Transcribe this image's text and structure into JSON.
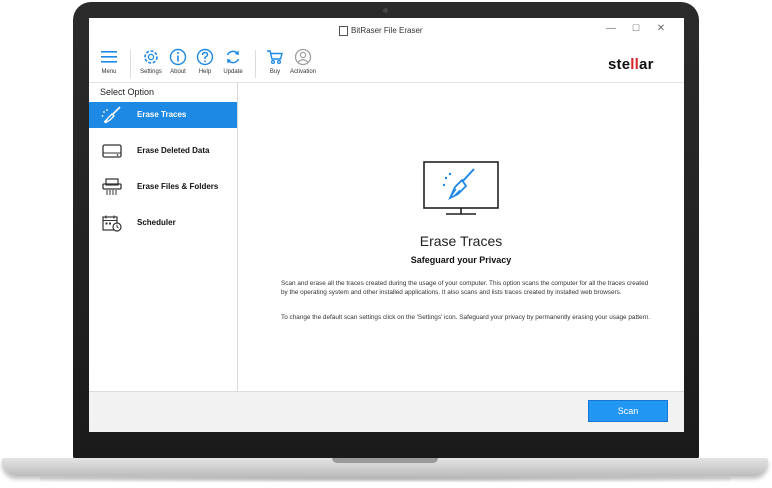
{
  "window": {
    "title": "BitRaser File Eraser",
    "controls": {
      "minimize": "—",
      "maximize": "☐",
      "close": "✕"
    }
  },
  "toolbar": {
    "items": [
      {
        "label": "Menu",
        "icon": "hamburger-icon"
      },
      {
        "label": "Settings",
        "icon": "gear-icon"
      },
      {
        "label": "About",
        "icon": "info-icon"
      },
      {
        "label": "Help",
        "icon": "help-icon"
      },
      {
        "label": "Update",
        "icon": "refresh-icon"
      },
      {
        "label": "Buy",
        "icon": "cart-icon"
      },
      {
        "label": "Activation",
        "icon": "user-icon"
      }
    ],
    "logo": {
      "pre": "ste",
      "mid": "ll",
      "post": "ar"
    }
  },
  "sidebar": {
    "title": "Select Option",
    "items": [
      {
        "label": "Erase Traces",
        "icon": "broom-icon",
        "active": true
      },
      {
        "label": "Erase Deleted Data",
        "icon": "drive-icon",
        "active": false
      },
      {
        "label": "Erase Files & Folders",
        "icon": "shredder-icon",
        "active": false
      },
      {
        "label": "Scheduler",
        "icon": "calendar-clock-icon",
        "active": false
      }
    ]
  },
  "main": {
    "heading": "Erase Traces",
    "subheading": "Safeguard your Privacy",
    "paragraph1": "Scan and erase all the traces created during the usage of your computer. This option scans the computer for all the traces created by the operating system and other installed applications. It also scans and lists traces created by installed web browsers.",
    "paragraph2": "To change the default scan settings click on the 'Settings' icon. Safeguard your privacy by permanently erasing your usage pattern."
  },
  "footer": {
    "scan_label": "Scan"
  },
  "colors": {
    "accent": "#1e88e5",
    "brand_red": "#d6242b",
    "frame": "#1f1f1f"
  }
}
